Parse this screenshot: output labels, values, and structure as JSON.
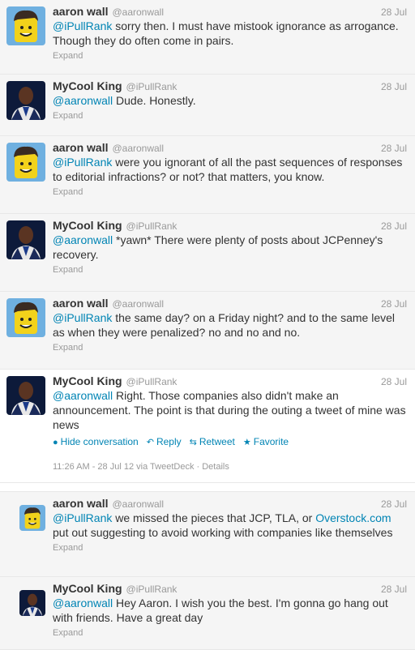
{
  "colors": {
    "link": "#0084b4",
    "muted": "#999999",
    "text": "#333333"
  },
  "tweets": [
    {
      "fullname": "aaron wall",
      "screen": "@aaronwall",
      "date": "28 Jul",
      "mention": "@iPullRank",
      "text": " sorry then. I must have mistook ignorance as arrogance. Though they do often come in pairs.",
      "expand": "Expand",
      "avatar": "lego-avatar"
    },
    {
      "fullname": "MyCool King",
      "screen": "@iPullRank",
      "date": "28 Jul",
      "mention": "@aaronwall",
      "text": " Dude. Honestly.",
      "expand": "Expand",
      "avatar": "person-avatar"
    },
    {
      "fullname": "aaron wall",
      "screen": "@aaronwall",
      "date": "28 Jul",
      "mention": "@iPullRank",
      "text": " were you ignorant of all the past sequences of responses to editorial infractions? or not? that matters, you know.",
      "expand": "Expand",
      "avatar": "lego-avatar"
    },
    {
      "fullname": "MyCool King",
      "screen": "@iPullRank",
      "date": "28 Jul",
      "mention": "@aaronwall",
      "text": " *yawn* There were plenty of posts about JCPenney's recovery.",
      "expand": "Expand",
      "avatar": "person-avatar"
    },
    {
      "fullname": "aaron wall",
      "screen": "@aaronwall",
      "date": "28 Jul",
      "mention": "@iPullRank",
      "text": " the same day? on a Friday night? and to the same level as when they were penalized? no and no and no.",
      "expand": "Expand",
      "avatar": "lego-avatar"
    }
  ],
  "open_tweet": {
    "fullname": "MyCool King",
    "screen": "@iPullRank",
    "date": "28 Jul",
    "mention": "@aaronwall",
    "text": " Right. Those companies also didn't make an announcement. The point is that during the outing a tweet of mine was news",
    "actions": {
      "hide": "Hide conversation",
      "reply": "Reply",
      "retweet": "Retweet",
      "favorite": "Favorite"
    },
    "meta": "11:26 AM - 28 Jul 12 via TweetDeck · Details",
    "avatar": "person-avatar"
  },
  "replies": [
    {
      "fullname": "aaron wall",
      "screen": "@aaronwall",
      "date": "28 Jul",
      "mention": "@iPullRank",
      "text_a": " we missed the pieces that JCP, TLA, or ",
      "link": "Overstock.com",
      "text_b": " put out suggesting to avoid working with companies like themselves",
      "expand": "Expand",
      "avatar": "lego-avatar"
    },
    {
      "fullname": "MyCool King",
      "screen": "@iPullRank",
      "date": "28 Jul",
      "mention": "@aaronwall",
      "text_a": " Hey Aaron. I wish you the best. I'm gonna go hang out with friends. Have a great day",
      "link": "",
      "text_b": "",
      "expand": "Expand",
      "avatar": "person-avatar"
    }
  ]
}
